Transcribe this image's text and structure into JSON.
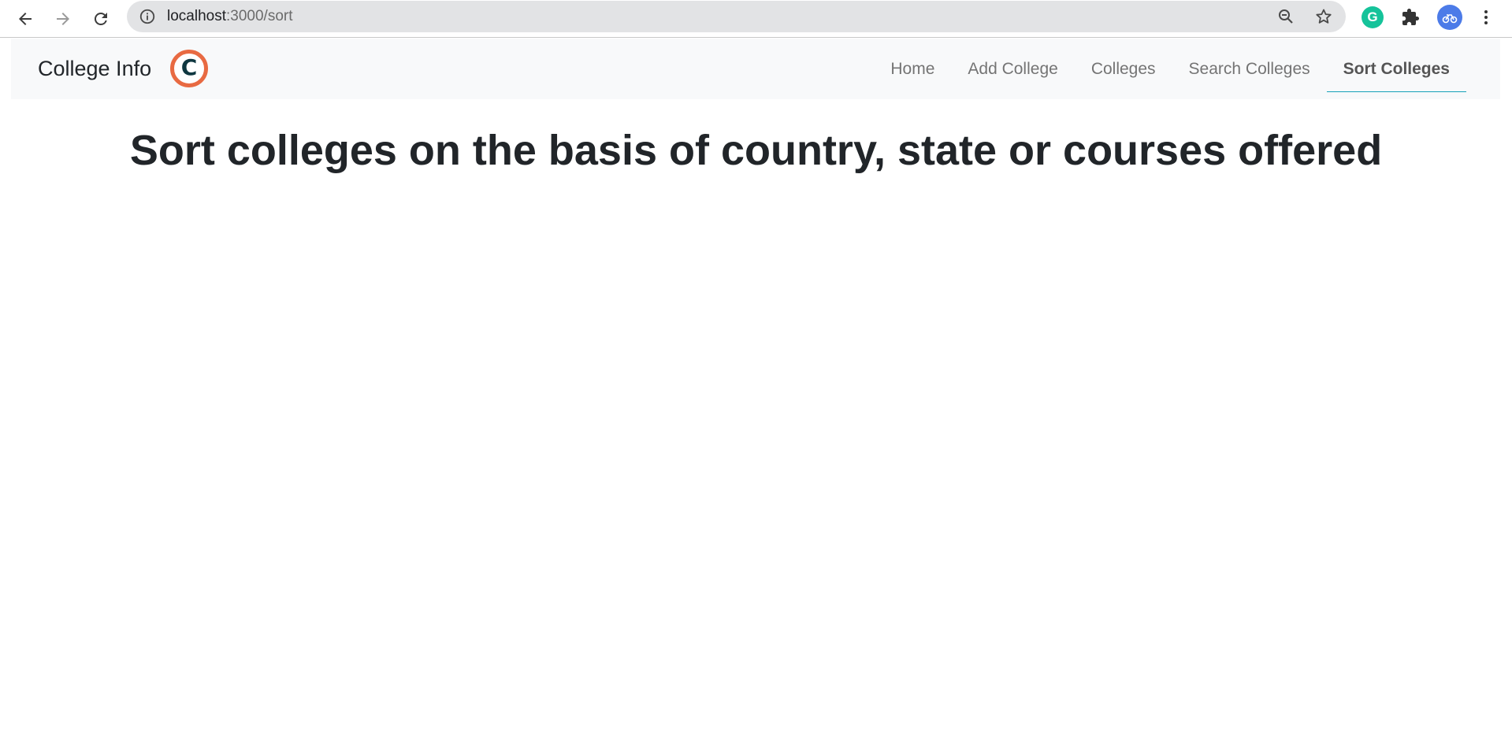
{
  "browser": {
    "url_host": "localhost",
    "url_path": ":3000/sort",
    "icons": {
      "back": "arrow-left-icon",
      "forward": "arrow-right-icon",
      "reload": "reload-icon",
      "site_info": "info-icon",
      "zoom": "zoom-out-icon",
      "bookmark": "star-icon",
      "grammarly": "grammarly-icon",
      "extensions": "puzzle-icon",
      "profile": "avatar-icon",
      "menu": "kebab-menu-icon"
    },
    "grammarly_letter": "G"
  },
  "navbar": {
    "brand": "College Info",
    "logo_letter": "C",
    "links": [
      {
        "label": "Home",
        "active": false
      },
      {
        "label": "Add College",
        "active": false
      },
      {
        "label": "Colleges",
        "active": false
      },
      {
        "label": "Search Colleges",
        "active": false
      },
      {
        "label": "Sort Colleges",
        "active": true
      }
    ]
  },
  "main": {
    "title": "Sort colleges on the basis of country, state or courses offered"
  },
  "colors": {
    "logo_ring": "#e86a42",
    "logo_letter": "#0f3740",
    "active_underline": "#17a2b8",
    "navbar_bg": "#f8f9fa"
  }
}
